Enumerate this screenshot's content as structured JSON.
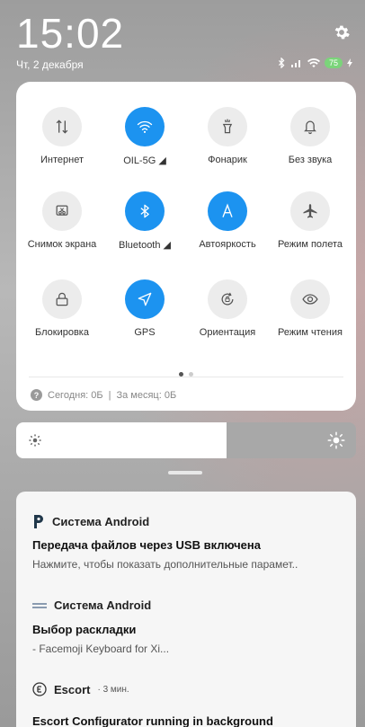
{
  "status_bar": {
    "time": "15:02",
    "date": "Чт, 2 декабря",
    "battery": "75"
  },
  "quick_settings": {
    "tiles": [
      {
        "id": "internet",
        "label": "Интернет",
        "active": false,
        "icon": "data-transfer-icon"
      },
      {
        "id": "wifi",
        "label": "OIL-5G ◢",
        "active": true,
        "icon": "wifi-icon"
      },
      {
        "id": "flashlight",
        "label": "Фонарик",
        "active": false,
        "icon": "flashlight-icon"
      },
      {
        "id": "silent",
        "label": "Без звука",
        "active": false,
        "icon": "bell-icon"
      },
      {
        "id": "screenshot",
        "label": "Снимок экрана",
        "active": false,
        "icon": "scissors-icon"
      },
      {
        "id": "bluetooth",
        "label": "Bluetooth ◢",
        "active": true,
        "icon": "bluetooth-icon"
      },
      {
        "id": "autobright",
        "label": "Автояркость",
        "active": true,
        "icon": "auto-brightness-icon"
      },
      {
        "id": "airplane",
        "label": "Режим полета",
        "active": false,
        "icon": "airplane-icon"
      },
      {
        "id": "lock",
        "label": "Блокировка",
        "active": false,
        "icon": "lock-icon"
      },
      {
        "id": "gps",
        "label": "GPS",
        "active": true,
        "icon": "location-arrow-icon"
      },
      {
        "id": "orientation",
        "label": "Ориентация",
        "active": false,
        "icon": "rotation-lock-icon"
      },
      {
        "id": "reading",
        "label": "Режим чтения",
        "active": false,
        "icon": "eye-icon"
      }
    ],
    "usage": {
      "today": "Сегодня: 0Б",
      "separator": "|",
      "month": "За месяц: 0Б"
    }
  },
  "brightness": {
    "level": 0.62
  },
  "notifications": [
    {
      "app": "Система Android",
      "icon": "p-logo-icon",
      "title": "Передача файлов через USB включена",
      "text": "Нажмите, чтобы показать дополнительные парамет.."
    },
    {
      "app": "Система Android",
      "icon": "keyboard-icon",
      "title": "Выбор раскладки",
      "text": "- Facemoji Keyboard for Xi..."
    },
    {
      "app": "Escort",
      "time": "· 3 мин.",
      "icon": "escort-logo-icon",
      "title": "Escort Configurator running in background"
    }
  ],
  "colors": {
    "accent": "#1c93f0",
    "tile_inactive": "#ececec",
    "battery": "#7bd47a"
  }
}
